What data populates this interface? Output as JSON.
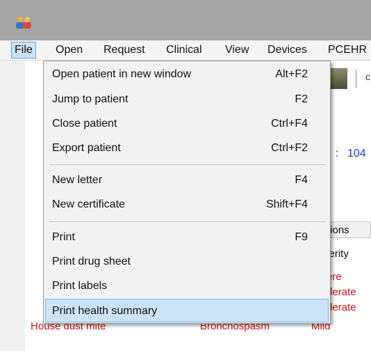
{
  "menubar": {
    "items": [
      {
        "label": "File"
      },
      {
        "label": "Open"
      },
      {
        "label": "Request"
      },
      {
        "label": "Clinical"
      },
      {
        "label": "View"
      },
      {
        "label": "Devices"
      },
      {
        "label": "PCEHR"
      }
    ]
  },
  "file_menu": {
    "items": [
      {
        "label": "Open patient in new window",
        "shortcut": "Alt+F2"
      },
      {
        "label": "Jump to patient",
        "shortcut": "F2"
      },
      {
        "label": "Close patient",
        "shortcut": "Ctrl+F4"
      },
      {
        "label": "Export patient",
        "shortcut": "Ctrl+F2"
      },
      {
        "label": "New letter",
        "shortcut": "F4"
      },
      {
        "label": "New certificate",
        "shortcut": "Shift+F4"
      },
      {
        "label": "Print",
        "shortcut": "F9"
      },
      {
        "label": "Print drug sheet",
        "shortcut": ""
      },
      {
        "label": "Print labels",
        "shortcut": ""
      },
      {
        "label": "Print health summary",
        "shortcut": ""
      }
    ],
    "highlighted": "Print health summary"
  },
  "background": {
    "toolbar_partial": "c",
    "colon": ":",
    "number": "104",
    "tab_header": "tions",
    "column_header": "verity",
    "severities": [
      "ere",
      "derate",
      "derate"
    ],
    "under_row": {
      "allergen": "House dust mite",
      "reaction": "Bronchospasm",
      "severity": "Mild"
    }
  },
  "colors": {
    "highlight": "#cde4f7",
    "severity_text": "#cc1111",
    "link_blue": "#1a3fb8"
  }
}
